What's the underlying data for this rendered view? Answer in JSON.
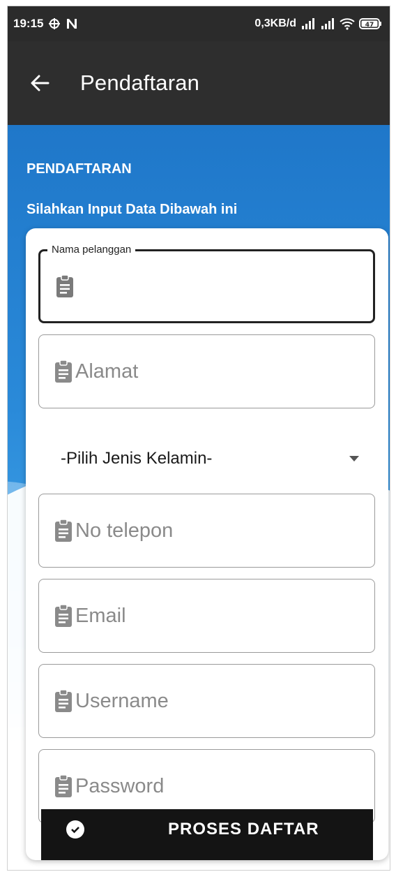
{
  "status_bar": {
    "time": "19:15",
    "network_speed": "0,3KB/d",
    "battery": "47"
  },
  "app_bar": {
    "title": "Pendaftaran"
  },
  "section": {
    "title": "PENDAFTARAN",
    "subtitle": "Silahkan Input Data Dibawah ini"
  },
  "form": {
    "fields": [
      {
        "label": "Nama pelanggan",
        "value": ""
      },
      {
        "placeholder": "Alamat"
      },
      {
        "placeholder": "No telepon"
      },
      {
        "placeholder": "Email"
      },
      {
        "placeholder": "Username"
      },
      {
        "placeholder": "Password"
      }
    ],
    "gender_select": {
      "selected": "-Pilih Jenis Kelamin-"
    },
    "submit_label": "PROSES DAFTAR"
  },
  "colors": {
    "header_bg": "#2e2e2e",
    "hero_blue": "#1f77c9",
    "button_bg": "#141414"
  }
}
